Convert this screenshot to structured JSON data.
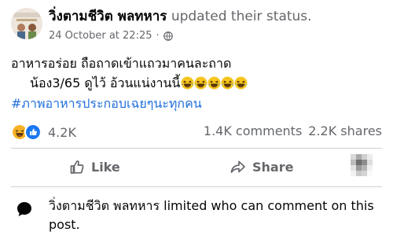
{
  "post": {
    "author": "วิ่งตามชีวิต พลทหาร",
    "action": "updated their status.",
    "timestamp": "24 October at 22:25",
    "dot": "·",
    "privacy_icon": "globe-icon",
    "line1": "อาหารอร่อย  ถือถาดเข้าแถวมาคนละถาด",
    "line2": "น้อง3/65 ดูไว้  อ้วนแน่งานนี้",
    "line2_emojis": [
      "laughing-emoji",
      "laughing-emoji",
      "laughing-emoji",
      "laughing-emoji",
      "laughing-emoji"
    ],
    "hashtag": "#ภาพอาหารประกอบเฉยๆนะทุกคน"
  },
  "stats": {
    "reaction_icons": [
      "haha-reaction-icon",
      "like-reaction-icon"
    ],
    "reactions": "4.2K",
    "comments": "1.4K comments",
    "shares": "2.2K shares"
  },
  "actions": {
    "like": "Like",
    "share": "Share"
  },
  "comment_notice": {
    "text": "วิ่งตามชีวิต พลทหาร limited who can comment on this post."
  },
  "colors": {
    "hashtag": "#216fdb",
    "like_blue": "#1877f2",
    "haha_yellow": "#f7b125",
    "secondary_text": "#65676b",
    "divider": "#ced0d4"
  }
}
